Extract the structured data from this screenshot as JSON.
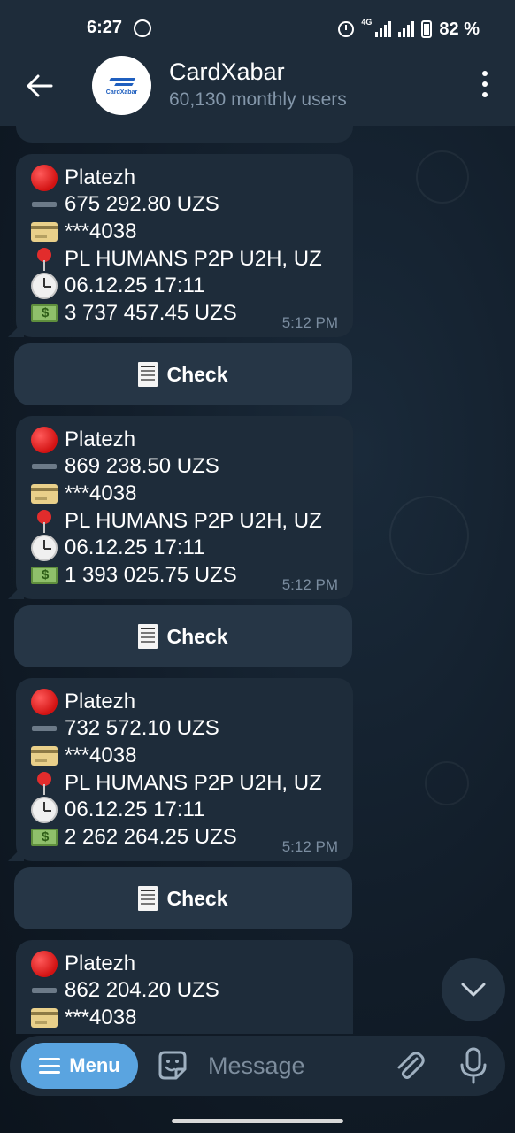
{
  "status_bar": {
    "time": "6:27",
    "network": "4G",
    "battery": "82 %"
  },
  "header": {
    "avatar_text": "CardXabar",
    "title": "CardXabar",
    "subtitle": "60,130 monthly users"
  },
  "messages": [
    {
      "type": "Platezh",
      "amount": "675 292.80 UZS",
      "card": "***4038",
      "location": "PL HUMANS P2P U2H, UZ",
      "datetime": "06.12.25 17:11",
      "balance": "3 737 457.45 UZS",
      "time": "5:12 PM",
      "button": "Check"
    },
    {
      "type": "Platezh",
      "amount": "869 238.50 UZS",
      "card": "***4038",
      "location": "PL HUMANS P2P U2H, UZ",
      "datetime": "06.12.25 17:11",
      "balance": "1 393 025.75 UZS",
      "time": "5:12 PM",
      "button": "Check"
    },
    {
      "type": "Platezh",
      "amount": "732 572.10 UZS",
      "card": "***4038",
      "location": "PL HUMANS P2P U2H, UZ",
      "datetime": "06.12.25 17:11",
      "balance": "2 262 264.25 UZS",
      "time": "5:12 PM",
      "button": "Check"
    },
    {
      "type": "Platezh",
      "amount": "862 204.20 UZS",
      "card": "***4038"
    }
  ],
  "input_bar": {
    "menu_label": "Menu",
    "placeholder": "Message"
  },
  "colors": {
    "accent": "#5aa4e0",
    "bubble": "#1e2c3a",
    "header": "#1e2c3a",
    "background": "#111c28"
  }
}
